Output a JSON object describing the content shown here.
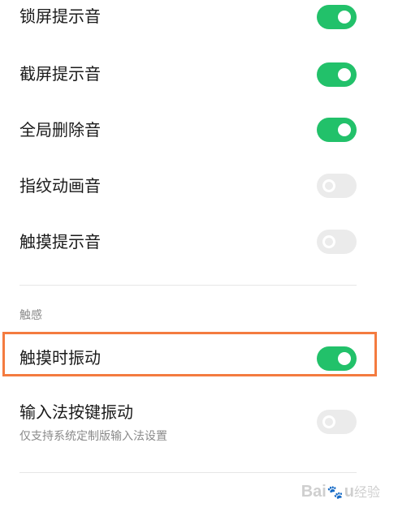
{
  "settings": {
    "items": [
      {
        "label": "锁屏提示音",
        "on": true
      },
      {
        "label": "截屏提示音",
        "on": true
      },
      {
        "label": "全局删除音",
        "on": true
      },
      {
        "label": "指纹动画音",
        "on": false
      },
      {
        "label": "触摸提示音",
        "on": false
      }
    ]
  },
  "haptics": {
    "section_title": "触感",
    "items": [
      {
        "label": "触摸时振动",
        "on": true
      },
      {
        "label": "输入法按键振动",
        "sublabel": "仅支持系统定制版输入法设置",
        "on": false
      }
    ]
  },
  "colors": {
    "toggle_on": "#22c16a",
    "toggle_off": "#ebebeb",
    "highlight_border": "#f47b3f"
  },
  "watermark": {
    "brand": "Bai",
    "brand_end": "u",
    "suffix": "经验",
    "icon": "paw-icon"
  }
}
